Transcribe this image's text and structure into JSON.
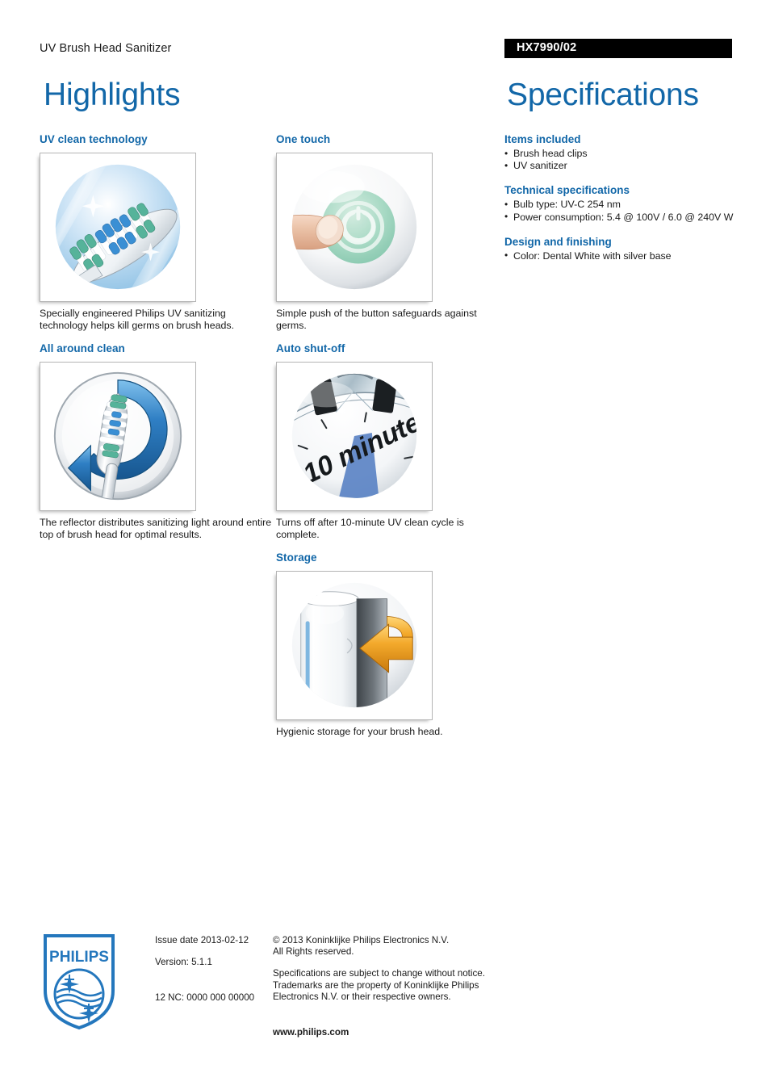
{
  "header": {
    "product_line": "UV Brush Head Sanitizer",
    "product_code": "HX7990/02",
    "highlights_title": "Highlights",
    "specifications_title": "Specifications",
    "accent_color": "#1267a8",
    "code_bar_color": "#000000"
  },
  "highlights": {
    "left": [
      {
        "heading": "UV clean technology",
        "image_name": "uv-clean-technology-image",
        "caption": "Specially engineered Philips UV sanitizing technology helps kill germs on brush heads."
      },
      {
        "heading": "All around clean",
        "image_name": "all-around-clean-image",
        "caption": "The reflector distributes sanitizing light around entire top of brush head for optimal results."
      }
    ],
    "middle": [
      {
        "heading": "One touch",
        "image_name": "one-touch-image",
        "caption": "Simple push of the button safeguards against germs."
      },
      {
        "heading": "Auto shut-off",
        "image_name": "auto-shut-off-image",
        "image_label": "10 minute",
        "caption": "Turns off after 10-minute UV clean cycle is complete."
      },
      {
        "heading": "Storage",
        "image_name": "storage-image",
        "caption": "Hygienic storage for your brush head."
      }
    ]
  },
  "specifications": [
    {
      "heading": "Items included",
      "items": [
        "Brush head clips",
        "UV sanitizer"
      ]
    },
    {
      "heading": "Technical specifications",
      "items": [
        "Bulb type: UV-C 254 nm",
        "Power consumption: 5.4 @ 100V / 6.0 @ 240V W"
      ]
    },
    {
      "heading": "Design and finishing",
      "items": [
        "Color: Dental White with silver base"
      ]
    }
  ],
  "footer": {
    "logo_wordmark": "PHILIPS",
    "issue_date": "Issue date 2013-02-12",
    "version": "Version: 5.1.1",
    "nc_code": "12 NC: 0000 000 00000",
    "copyright_line1": "© 2013 Koninklijke Philips Electronics N.V.",
    "copyright_line2": "All Rights reserved.",
    "disclaimer_line1": "Specifications are subject to change without notice.",
    "disclaimer_line2": "Trademarks are the property of Koninklijke Philips",
    "disclaimer_line3": "Electronics N.V. or their respective owners.",
    "website": "www.philips.com"
  }
}
